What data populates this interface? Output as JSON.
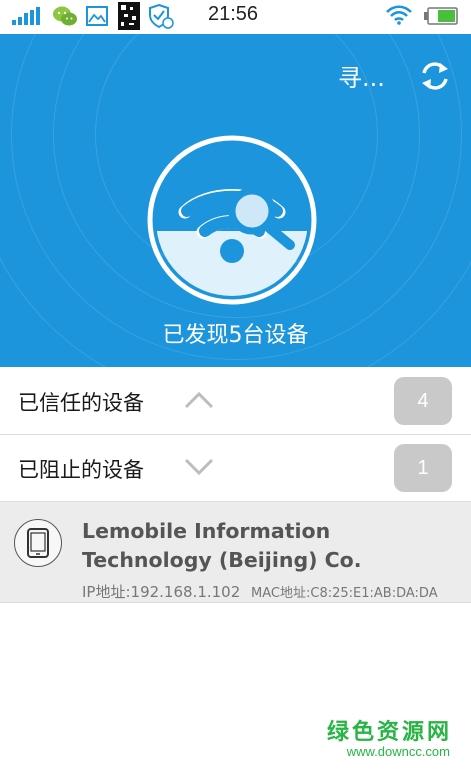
{
  "status_bar": {
    "time": "21:56",
    "icons": [
      "signal-icon",
      "wechat-icon",
      "image-icon",
      "qr-code-icon",
      "security-shield-icon",
      "wifi-icon",
      "battery-icon"
    ]
  },
  "header": {
    "search_label": "寻...",
    "refresh_icon": "refresh-icon"
  },
  "hero": {
    "icon": "wifi-search-icon",
    "caption": "已发现5台设备"
  },
  "groups": [
    {
      "label": "已信任的设备",
      "count": "4",
      "expanded": true
    },
    {
      "label": "已阻止的设备",
      "count": "1",
      "expanded": false
    }
  ],
  "device": {
    "icon": "smartphone-icon",
    "name": "Lemobile Information Technology (Beijing) Co.",
    "ip": "IP地址:192.168.1.102",
    "mac": "MAC地址:C8:25:E1:AB:DA:DA"
  },
  "watermark": {
    "line1": "绿色资源网",
    "line2": "www.downcc.com"
  },
  "colors": {
    "primary": "#1c95dc",
    "badge": "#c9c9c9",
    "selected_row": "#ececec",
    "watermark": "#27b544"
  }
}
